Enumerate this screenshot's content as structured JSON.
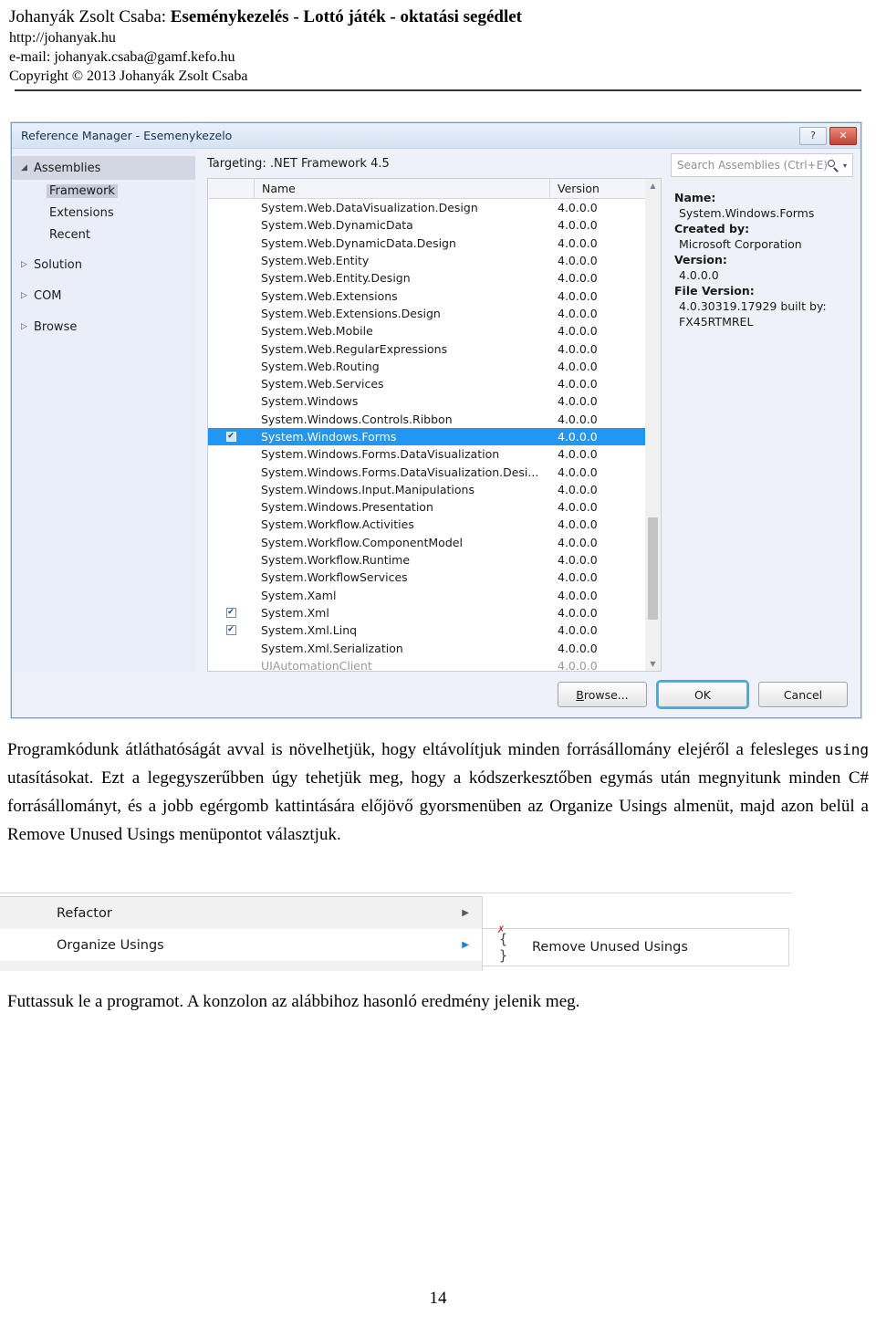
{
  "document": {
    "header": {
      "author": "Johanyák Zsolt Csaba:",
      "subject": "Eseménykezelés - Lottó játék - oktatási segédlet",
      "url": "http://johanyak.hu",
      "email": "e-mail: johanyak.csaba@gamf.kefo.hu",
      "copyright": "Copyright © 2013 Johanyák Zsolt Csaba"
    },
    "paragraph_1_parts": {
      "a": "Programkódunk átláthatóságát avval is növelhetjük, hogy eltávolítjuk minden forrásállomány elejéről a felesleges ",
      "code": "using",
      "b": " utasításokat. Ezt a legegyszerűbben úgy tehetjük meg, hogy a kódszerkesztőben egymás után megnyitunk minden C# forrásállományt, és a jobb egérgomb kattintására előjövő gyorsmenüben az Organize Usings almenüt, majd azon belül a Remove Unused Usings menüpontot választjuk."
    },
    "paragraph_2": "Futtassuk le a programot. A konzolon az alábbihoz hasonló eredmény jelenik meg.",
    "page_number": "14"
  },
  "reference_manager": {
    "titlebar": {
      "title": "Reference Manager - Esemenykezelo",
      "help_label": "?",
      "close_label": "✕"
    },
    "nav": [
      {
        "label": "Assemblies",
        "type": "group",
        "expanded": true,
        "triangle": "◢",
        "selected": true
      },
      {
        "label": "Framework",
        "type": "child",
        "selected": true
      },
      {
        "label": "Extensions",
        "type": "child",
        "selected": false
      },
      {
        "label": "Recent",
        "type": "child",
        "selected": false
      },
      {
        "label": "Solution",
        "type": "group",
        "expanded": false,
        "triangle": "▷",
        "selected": false
      },
      {
        "label": "COM",
        "type": "group",
        "expanded": false,
        "triangle": "▷",
        "selected": false
      },
      {
        "label": "Browse",
        "type": "group",
        "expanded": false,
        "triangle": "▷",
        "selected": false
      }
    ],
    "targeting": "Targeting: .NET Framework 4.5",
    "columns": {
      "name": "Name",
      "version": "Version"
    },
    "rows": [
      {
        "name": "System.Web.DataVisualization.Design",
        "version": "4.0.0.0",
        "checked": false,
        "selected": false
      },
      {
        "name": "System.Web.DynamicData",
        "version": "4.0.0.0",
        "checked": false,
        "selected": false
      },
      {
        "name": "System.Web.DynamicData.Design",
        "version": "4.0.0.0",
        "checked": false,
        "selected": false
      },
      {
        "name": "System.Web.Entity",
        "version": "4.0.0.0",
        "checked": false,
        "selected": false
      },
      {
        "name": "System.Web.Entity.Design",
        "version": "4.0.0.0",
        "checked": false,
        "selected": false
      },
      {
        "name": "System.Web.Extensions",
        "version": "4.0.0.0",
        "checked": false,
        "selected": false
      },
      {
        "name": "System.Web.Extensions.Design",
        "version": "4.0.0.0",
        "checked": false,
        "selected": false
      },
      {
        "name": "System.Web.Mobile",
        "version": "4.0.0.0",
        "checked": false,
        "selected": false
      },
      {
        "name": "System.Web.RegularExpressions",
        "version": "4.0.0.0",
        "checked": false,
        "selected": false
      },
      {
        "name": "System.Web.Routing",
        "version": "4.0.0.0",
        "checked": false,
        "selected": false
      },
      {
        "name": "System.Web.Services",
        "version": "4.0.0.0",
        "checked": false,
        "selected": false
      },
      {
        "name": "System.Windows",
        "version": "4.0.0.0",
        "checked": false,
        "selected": false
      },
      {
        "name": "System.Windows.Controls.Ribbon",
        "version": "4.0.0.0",
        "checked": false,
        "selected": false
      },
      {
        "name": "System.Windows.Forms",
        "version": "4.0.0.0",
        "checked": true,
        "selected": true
      },
      {
        "name": "System.Windows.Forms.DataVisualization",
        "version": "4.0.0.0",
        "checked": false,
        "selected": false
      },
      {
        "name": "System.Windows.Forms.DataVisualization.Desi...",
        "version": "4.0.0.0",
        "checked": false,
        "selected": false
      },
      {
        "name": "System.Windows.Input.Manipulations",
        "version": "4.0.0.0",
        "checked": false,
        "selected": false
      },
      {
        "name": "System.Windows.Presentation",
        "version": "4.0.0.0",
        "checked": false,
        "selected": false
      },
      {
        "name": "System.Workflow.Activities",
        "version": "4.0.0.0",
        "checked": false,
        "selected": false
      },
      {
        "name": "System.Workflow.ComponentModel",
        "version": "4.0.0.0",
        "checked": false,
        "selected": false
      },
      {
        "name": "System.Workflow.Runtime",
        "version": "4.0.0.0",
        "checked": false,
        "selected": false
      },
      {
        "name": "System.WorkflowServices",
        "version": "4.0.0.0",
        "checked": false,
        "selected": false
      },
      {
        "name": "System.Xaml",
        "version": "4.0.0.0",
        "checked": false,
        "selected": false
      },
      {
        "name": "System.Xml",
        "version": "4.0.0.0",
        "checked": true,
        "selected": false
      },
      {
        "name": "System.Xml.Linq",
        "version": "4.0.0.0",
        "checked": true,
        "selected": false
      },
      {
        "name": "System.Xml.Serialization",
        "version": "4.0.0.0",
        "checked": false,
        "selected": false
      },
      {
        "name": "UIAutomationClient",
        "version": "4.0.0.0",
        "checked": false,
        "selected": false,
        "clipped": true
      }
    ],
    "scrollbar": {
      "up_arrow": "▲",
      "down_arrow": "▼",
      "thumb_top_pct": 70,
      "thumb_height_pct": 22
    },
    "search": {
      "placeholder": "Search Assemblies (Ctrl+E)",
      "value": ""
    },
    "details": {
      "name_label": "Name:",
      "name_value": "System.Windows.Forms",
      "created_by_label": "Created by:",
      "created_by_value": "Microsoft Corporation",
      "version_label": "Version:",
      "version_value": "4.0.0.0",
      "file_version_label": "File Version:",
      "file_version_value_1": "4.0.30319.17929 built by:",
      "file_version_value_2": "FX45RTMREL"
    },
    "buttons": {
      "browse": "Browse...",
      "browse_accel": "B",
      "browse_rest": "rowse...",
      "ok": "OK",
      "cancel": "Cancel"
    },
    "accent": "#2196f3"
  },
  "context_menu": {
    "items": [
      {
        "label": "Refactor",
        "has_submenu": true,
        "highlighted": false,
        "arrow": "▶"
      },
      {
        "label": "Organize Usings",
        "has_submenu": true,
        "highlighted": true,
        "arrow": "▶"
      }
    ],
    "submenu": {
      "label": "Remove Unused Usings",
      "icon_braces": "{ }",
      "icon_x": "✗"
    },
    "highlight_color": "#1d7fd0"
  }
}
